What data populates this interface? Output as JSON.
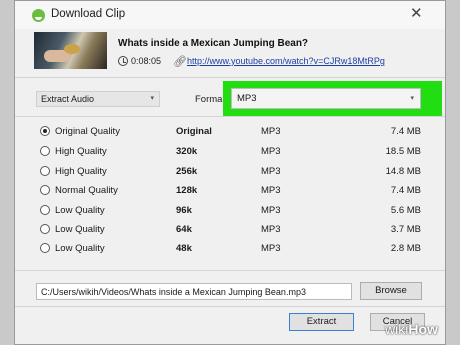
{
  "dialog": {
    "title": "Download Clip",
    "close_glyph": "✕",
    "icon": "download-clip-app-icon"
  },
  "video": {
    "title": "Whats inside a Mexican Jumping Bean?",
    "duration": "0:08:05",
    "url": "http://www.youtube.com/watch?v=CJRw18MtRPg"
  },
  "options": {
    "mode_selected": "Extract Audio",
    "format_label": "Forma",
    "format_selected": "MP3",
    "highlight_color": "#22dd11"
  },
  "qualities": [
    {
      "name": "Original Quality",
      "bitrate": "Original",
      "format": "MP3",
      "size": "7.4 MB",
      "selected": true
    },
    {
      "name": "High Quality",
      "bitrate": "320k",
      "format": "MP3",
      "size": "18.5 MB",
      "selected": false
    },
    {
      "name": "High Quality",
      "bitrate": "256k",
      "format": "MP3",
      "size": "14.8 MB",
      "selected": false
    },
    {
      "name": "Normal Quality",
      "bitrate": "128k",
      "format": "MP3",
      "size": "7.4 MB",
      "selected": false
    },
    {
      "name": "Low Quality",
      "bitrate": "96k",
      "format": "MP3",
      "size": "5.6 MB",
      "selected": false
    },
    {
      "name": "Low Quality",
      "bitrate": "64k",
      "format": "MP3",
      "size": "3.7 MB",
      "selected": false
    },
    {
      "name": "Low Quality",
      "bitrate": "48k",
      "format": "MP3",
      "size": "2.8 MB",
      "selected": false
    }
  ],
  "output": {
    "path": "C:/Users/wikih/Videos/Whats inside a Mexican Jumping Bean.mp3",
    "browse_label": "Browse"
  },
  "footer": {
    "extract_label": "Extract",
    "cancel_label": "Cancel"
  },
  "watermark": {
    "part1": "wiki",
    "part2": "How"
  }
}
